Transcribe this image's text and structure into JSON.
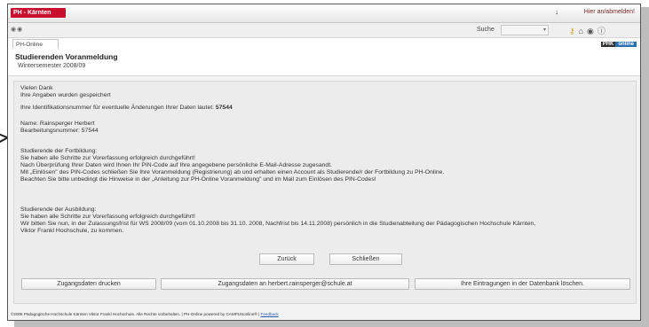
{
  "titlebar": {
    "brand": "PH - Kärnten",
    "logout": "Hier an/abmelden!"
  },
  "toolbar": {
    "search_label": "Suche",
    "search_value": ""
  },
  "tabs": {
    "active": "PH-Online",
    "badge_left": "PHK",
    "badge_right": "online"
  },
  "page": {
    "title": "Studierenden Voranmeldung",
    "subtitle": "Wintersemester 2008/09"
  },
  "content": {
    "thanks": "Vielen Dank\nIhre Angaben wurden gespeichert",
    "id_text": "Ihre Identifikationsnummer für eventuelle Änderungen Ihrer Daten lautet: ",
    "id_number": "57544",
    "name_block": "Name: Rainsperger Herbert\nBearbeitungsnummer: 57544",
    "fortbildung": "Studierende der Fortbildung:\nSie haben alle Schritte zur Vorerfassung erfolgreich durchgeführt!\nNach Überprüfung Ihrer Daten wird Ihnen Ihr PIN-Code auf Ihre angegebene persönliche E-Mail-Adresse zugesandt.\nMit „Einlösen\" des PIN-Codes schließen Sie Ihre Voranmeldung (Registrierung) ab und erhalten einen Account als Studierende/r der Fortbildung zu PH-Online.\nBeachten Sie bitte unbedingt die Hinweise in der „Anleitung zur PH-Online Voranmeldung\" und im Mail zum Einlösen des PIN-Codes!",
    "ausbildung": "Studierende der Ausbildung:\nSie haben alle Schritte zur Vorerfassung erfolgreich durchgeführt!\nWir bitten Sie nun, in der Zulassungsfrist für WS 2008/09 (vom 01.10.2008 bis 31.10. 2008, Nachfrist bis 14.11.2008) persönlich in die Studienabteilung der Pädagogischen Hochschule Kärnten,\nViktor Frankl Hochschule, zu kommen."
  },
  "buttons": {
    "back": "Zurück",
    "close": "Schließen",
    "print": "Zugangsdaten drucken",
    "send": "Zugangsdaten an herbert.rainsperger@schule.at",
    "delete": "Ihre Eintragungen in der Datenbank löschen."
  },
  "footer": {
    "text": "©2008 Pädagogische Hochschule Kärnten Viktor Frankl Hochschule. Alle Rechte vorbehalten. | PH-Online powered by CAMPUSonline® | ",
    "feedback": "Feedback"
  },
  "colors": {
    "brand": "#c8102e",
    "panel": "#ececec",
    "key_icon": "#d4a52a"
  }
}
